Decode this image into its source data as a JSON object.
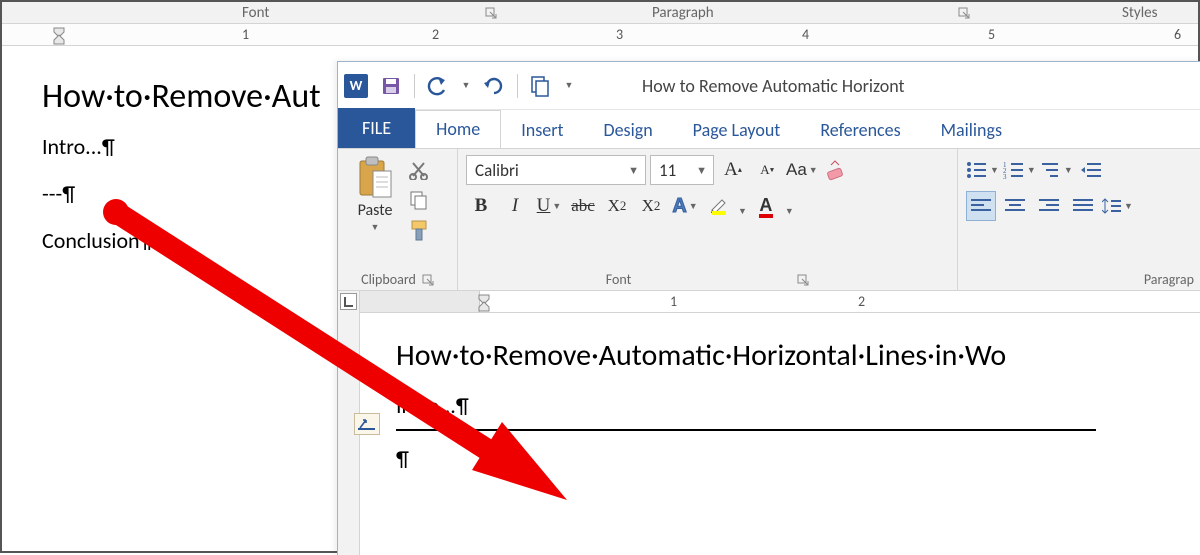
{
  "bg": {
    "groups": {
      "font": "Font",
      "paragraph": "Paragraph",
      "styles": "Styles"
    },
    "ruler_numbers": [
      "1",
      "2",
      "3",
      "4",
      "5",
      "6"
    ],
    "doc": {
      "title_partial": "How·to·Remove·Aut",
      "line1": "Intro...¶",
      "line2": "---¶",
      "line3": "Conclusion¶"
    }
  },
  "fg": {
    "titlebar": {
      "doc_title_partial": "How to Remove Automatic Horizont"
    },
    "tabs": {
      "file": "FILE",
      "home": "Home",
      "insert": "Insert",
      "design": "Design",
      "page_layout": "Page Layout",
      "references": "References",
      "mailings": "Mailings"
    },
    "ribbon": {
      "clipboard": {
        "paste": "Paste",
        "label": "Clipboard"
      },
      "font": {
        "name": "Calibri",
        "size": "11",
        "case_label": "Aa",
        "label": "Font"
      },
      "paragraph": {
        "label": "Paragrap"
      }
    },
    "ruler_numbers": [
      "1",
      "2"
    ],
    "doc": {
      "title_partial": "How·to·Remove·Automatic·Horizontal·Lines·in·Wo",
      "line1": "Intro...¶",
      "line_after_hr": "¶"
    }
  }
}
